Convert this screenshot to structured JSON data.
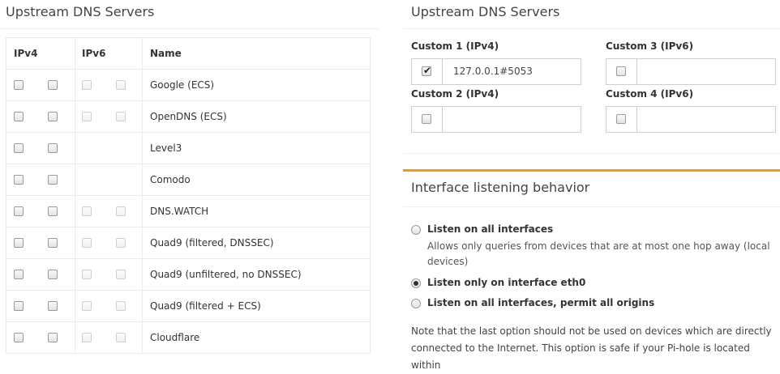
{
  "left_panel": {
    "title": "Upstream DNS Servers",
    "headers": {
      "ipv4": "IPv4",
      "ipv6": "IPv6",
      "name": "Name"
    },
    "servers": [
      {
        "name": "Google (ECS)",
        "ipv6": true
      },
      {
        "name": "OpenDNS (ECS)",
        "ipv6": true
      },
      {
        "name": "Level3",
        "ipv6": false
      },
      {
        "name": "Comodo",
        "ipv6": false
      },
      {
        "name": "DNS.WATCH",
        "ipv6": true
      },
      {
        "name": "Quad9 (filtered, DNSSEC)",
        "ipv6": true
      },
      {
        "name": "Quad9 (unfiltered, no DNSSEC)",
        "ipv6": true
      },
      {
        "name": "Quad9 (filtered + ECS)",
        "ipv6": true
      },
      {
        "name": "Cloudflare",
        "ipv6": true
      }
    ]
  },
  "right_panel": {
    "title": "Upstream DNS Servers",
    "custom": [
      {
        "label": "Custom 1 (IPv4)",
        "value": "127.0.0.1#5053",
        "checked": true
      },
      {
        "label": "Custom 2 (IPv4)",
        "value": "",
        "checked": false
      },
      {
        "label": "Custom 3 (IPv6)",
        "value": "",
        "checked": false
      },
      {
        "label": "Custom 4 (IPv6)",
        "value": "",
        "checked": false
      }
    ],
    "checkmark": "✔"
  },
  "interface": {
    "title": "Interface listening behavior",
    "options": [
      {
        "label": "Listen on all interfaces",
        "selected": false
      },
      {
        "label": "Listen only on interface eth0",
        "selected": true
      },
      {
        "label": "Listen on all interfaces, permit all origins",
        "selected": false
      }
    ],
    "option0_help_line1": "Allows only queries from devices that are at most one hop away (local",
    "option0_help_line2": "devices)",
    "note_line1": "Note that the last option should not be used on devices which are directly",
    "note_line2": "connected to the Internet. This option is safe if your Pi-hole is located within"
  },
  "colors": {
    "accent": "#f39c12"
  }
}
